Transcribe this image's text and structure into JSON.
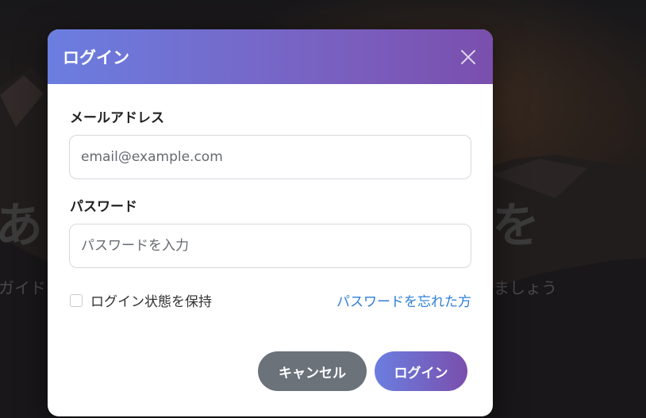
{
  "background": {
    "hero_title_visible": "あな",
    "hero_title_tail": "を",
    "hero_subtitle_visible": "ガイド",
    "hero_subtitle_tail": "ましょう"
  },
  "modal": {
    "title": "ログイン",
    "close_icon": "close-icon",
    "email": {
      "label": "メールアドレス",
      "placeholder": "email@example.com",
      "value": ""
    },
    "password": {
      "label": "パスワード",
      "placeholder": "パスワードを入力",
      "value": ""
    },
    "remember_me": {
      "label": "ログイン状態を保持",
      "checked": false
    },
    "forgot_password_link": "パスワードを忘れた方",
    "cancel_button": "キャンセル",
    "login_button": "ログイン"
  },
  "colors": {
    "header_gradient_start": "#6b7ee0",
    "header_gradient_end": "#7a4fad",
    "link": "#2f7fd8",
    "cancel_button": "#6b7279"
  }
}
